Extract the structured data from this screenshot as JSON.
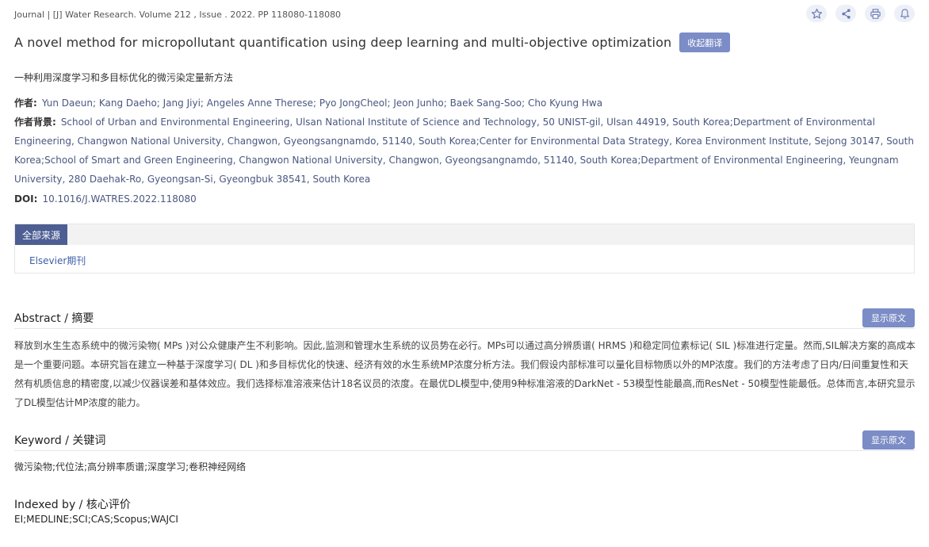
{
  "journal_line": "Journal | [J] Water Research. Volume 212 , Issue . 2022. PP 118080-118080",
  "actions": [
    {
      "icon": "star-icon"
    },
    {
      "icon": "share-icon"
    },
    {
      "icon": "print-icon"
    },
    {
      "icon": "bell-icon"
    }
  ],
  "title": "A novel method for micropollutant quantification using deep learning and multi-objective optimization",
  "collapse_translation_label": "收起翻译",
  "translated_title": "一种利用深度学习和多目标优化的微污染定量新方法",
  "authors": {
    "label": "作者:",
    "value": "Yun Daeun; Kang Daeho; Jang Jiyi; Angeles Anne Therese; Pyo JongCheol; Jeon Junho; Baek Sang-Soo; Cho Kyung Hwa"
  },
  "affiliation": {
    "label": "作者背景:",
    "value": "School of Urban and Environmental Engineering, Ulsan National Institute of Science and Technology, 50 UNIST-gil, Ulsan 44919, South Korea;Department of Environmental Engineering, Changwon National University, Changwon, Gyeongsangnamdo, 51140, South Korea;Center for Environmental Data Strategy, Korea Environment Institute, Sejong 30147, South Korea;School of Smart and Green Engineering, Changwon National University, Changwon, Gyeongsangnamdo, 51140, South Korea;Department of Environmental Engineering, Yeungnam University, 280 Daehak-Ro, Gyeongsan-Si, Gyeongbuk 38541, South Korea"
  },
  "doi": {
    "label": "DOI:",
    "value": "10.1016/J.WATRES.2022.118080"
  },
  "sources": {
    "tab_label": "全部来源",
    "link": "Elsevier期刊"
  },
  "abstract": {
    "heading": "Abstract / 摘要",
    "show_original_label": "显示原文",
    "text": "释放到水生生态系统中的微污染物( MPs )对公众健康产生不利影响。因此,监测和管理水生系统的议员势在必行。MPs可以通过高分辨质谱( HRMS )和稳定同位素标记( SIL )标准进行定量。然而,SIL解决方案的高成本是一个重要问题。本研究旨在建立一种基于深度学习( DL )和多目标优化的快速、经济有效的水生系统MP浓度分析方法。我们假设内部标准可以量化目标物质以外的MP浓度。我们的方法考虑了日内/日间重复性和天然有机质信息的精密度,以减少仪器误差和基体效应。我们选择标准溶液来估计18名议员的浓度。在最优DL模型中,使用9种标准溶液的DarkNet - 53模型性能最高,而ResNet - 50模型性能最低。总体而言,本研究显示了DL模型估计MP浓度的能力。"
  },
  "keyword": {
    "heading": "Keyword / 关键词",
    "show_original_label": "显示原文",
    "text": "微污染物;代位法;高分辨率质谱;深度学习;卷积神经网络"
  },
  "indexed": {
    "heading": "Indexed by / 核心评价",
    "text": "EI;MEDLINE;SCI;CAS;Scopus;WAJCI"
  }
}
